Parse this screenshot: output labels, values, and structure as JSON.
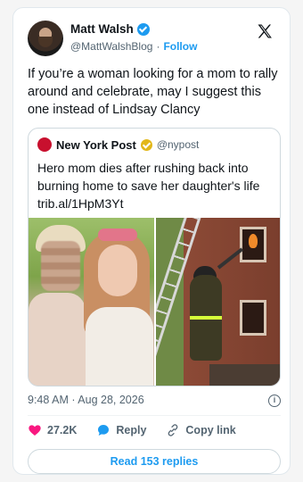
{
  "author": {
    "name": "Matt Walsh",
    "handle": "@MattWalshBlog",
    "separator": "·",
    "follow_label": "Follow"
  },
  "tweet": {
    "text": "If you’re a woman looking for a mom to rally around and celebrate, may I suggest this one instead of Lindsay Clancy"
  },
  "quoted": {
    "name": "New York Post",
    "handle": "@nypost",
    "logo_text": "NEW YORK POST",
    "text": "Hero mom dies after rushing back into burning home to save her daughter's life trib.al/1HpM3Yt"
  },
  "meta": {
    "timestamp": "9:48 AM · Aug 28, 2026",
    "info_glyph": "i"
  },
  "actions": {
    "likes": "27.2K",
    "reply_label": "Reply",
    "copy_link_label": "Copy link"
  },
  "read_replies_label": "Read 153 replies",
  "icons": [
    "verified-badge",
    "x-logo",
    "gold-verified-badge",
    "info-icon",
    "heart-icon",
    "reply-bubble-icon",
    "link-icon"
  ],
  "colors": {
    "accent": "#1d9bf0",
    "heart": "#f91880",
    "text": "#0f1419",
    "muted": "#536471",
    "nyp_red": "#c8102e",
    "gold_badge": "#e2b719"
  }
}
